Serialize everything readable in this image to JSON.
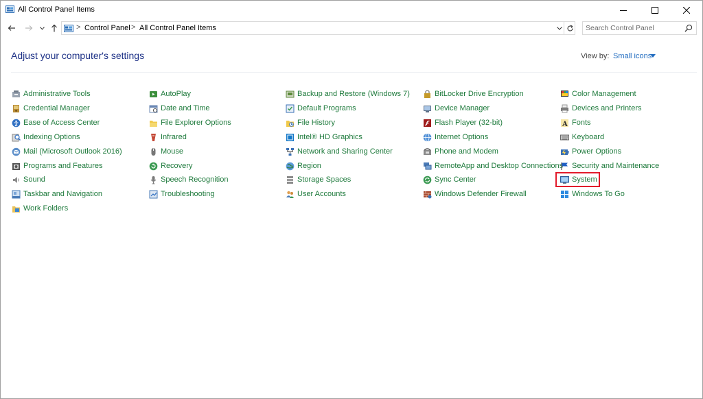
{
  "window": {
    "title": "All Control Panel Items"
  },
  "address": {
    "segments": [
      "Control Panel",
      "All Control Panel Items"
    ],
    "separator": ">"
  },
  "search": {
    "placeholder": "Search Control Panel"
  },
  "header": {
    "heading": "Adjust your computer's settings",
    "view_by_label": "View by:",
    "view_by_value": "Small icons"
  },
  "colors": {
    "item_text": "#1e7a3c",
    "heading": "#1e3287",
    "link": "#1e6abf",
    "highlight_box": "#e21b2b"
  },
  "highlighted_item": "System",
  "columns": [
    {
      "items": [
        {
          "label": "Administrative Tools",
          "icon": "administrative-tools-icon"
        },
        {
          "label": "Credential Manager",
          "icon": "credential-manager-icon"
        },
        {
          "label": "Ease of Access Center",
          "icon": "ease-of-access-icon"
        },
        {
          "label": "Indexing Options",
          "icon": "indexing-options-icon"
        },
        {
          "label": "Mail (Microsoft Outlook 2016)",
          "icon": "mail-icon"
        },
        {
          "label": "Programs and Features",
          "icon": "programs-features-icon"
        },
        {
          "label": "Sound",
          "icon": "sound-icon"
        },
        {
          "label": "Taskbar and Navigation",
          "icon": "taskbar-icon"
        },
        {
          "label": "Work Folders",
          "icon": "work-folders-icon"
        }
      ]
    },
    {
      "items": [
        {
          "label": "AutoPlay",
          "icon": "autoplay-icon"
        },
        {
          "label": "Date and Time",
          "icon": "date-time-icon"
        },
        {
          "label": "File Explorer Options",
          "icon": "file-explorer-icon"
        },
        {
          "label": "Infrared",
          "icon": "infrared-icon"
        },
        {
          "label": "Mouse",
          "icon": "mouse-icon"
        },
        {
          "label": "Recovery",
          "icon": "recovery-icon"
        },
        {
          "label": "Speech Recognition",
          "icon": "speech-recognition-icon"
        },
        {
          "label": "Troubleshooting",
          "icon": "troubleshooting-icon"
        }
      ]
    },
    {
      "items": [
        {
          "label": "Backup and Restore (Windows 7)",
          "icon": "backup-restore-icon"
        },
        {
          "label": "Default Programs",
          "icon": "default-programs-icon"
        },
        {
          "label": "File History",
          "icon": "file-history-icon"
        },
        {
          "label": "Intel® HD Graphics",
          "icon": "intel-graphics-icon"
        },
        {
          "label": "Network and Sharing Center",
          "icon": "network-icon"
        },
        {
          "label": "Region",
          "icon": "region-icon"
        },
        {
          "label": "Storage Spaces",
          "icon": "storage-spaces-icon"
        },
        {
          "label": "User Accounts",
          "icon": "user-accounts-icon"
        }
      ]
    },
    {
      "items": [
        {
          "label": "BitLocker Drive Encryption",
          "icon": "bitlocker-icon"
        },
        {
          "label": "Device Manager",
          "icon": "device-manager-icon"
        },
        {
          "label": "Flash Player (32-bit)",
          "icon": "flash-player-icon"
        },
        {
          "label": "Internet Options",
          "icon": "internet-options-icon"
        },
        {
          "label": "Phone and Modem",
          "icon": "phone-modem-icon"
        },
        {
          "label": "RemoteApp and Desktop Connections",
          "icon": "remoteapp-icon"
        },
        {
          "label": "Sync Center",
          "icon": "sync-center-icon"
        },
        {
          "label": "Windows Defender Firewall",
          "icon": "firewall-icon"
        }
      ]
    },
    {
      "items": [
        {
          "label": "Color Management",
          "icon": "color-management-icon"
        },
        {
          "label": "Devices and Printers",
          "icon": "devices-printers-icon"
        },
        {
          "label": "Fonts",
          "icon": "fonts-icon"
        },
        {
          "label": "Keyboard",
          "icon": "keyboard-icon"
        },
        {
          "label": "Power Options",
          "icon": "power-options-icon"
        },
        {
          "label": "Security and Maintenance",
          "icon": "security-maintenance-icon"
        },
        {
          "label": "System",
          "icon": "system-icon"
        },
        {
          "label": "Windows To Go",
          "icon": "windows-to-go-icon"
        }
      ]
    }
  ]
}
